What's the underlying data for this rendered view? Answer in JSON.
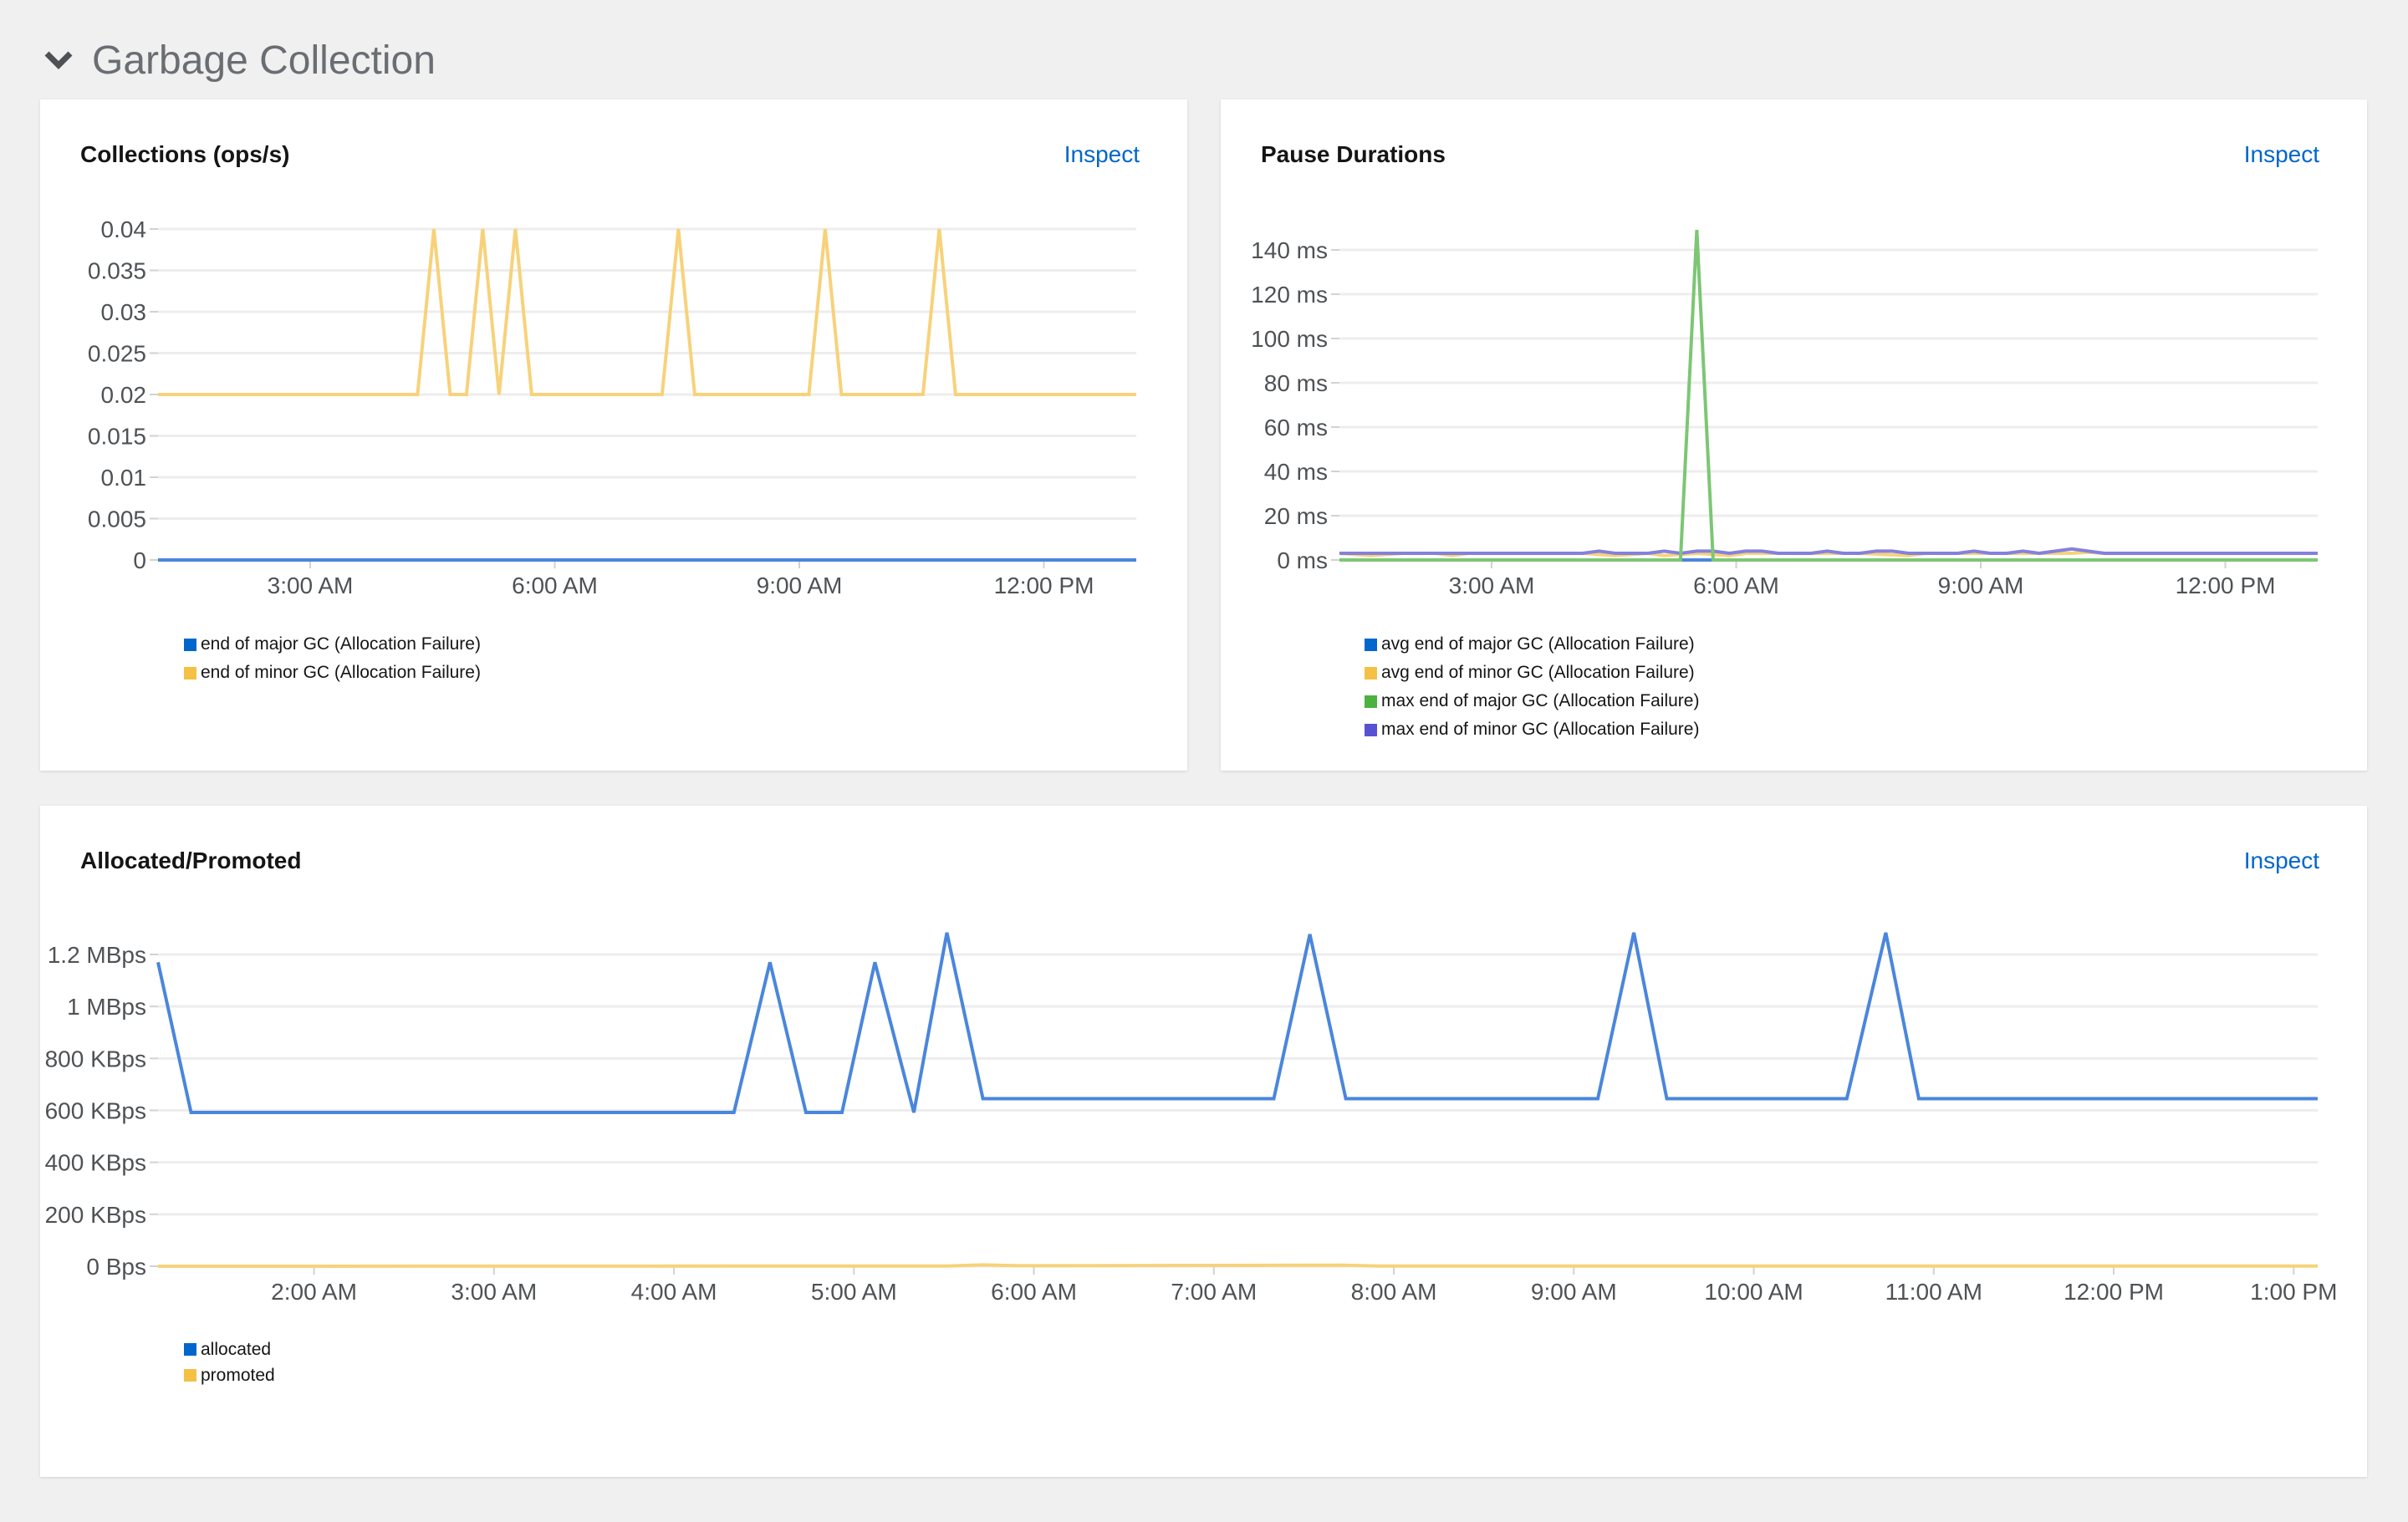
{
  "section": {
    "title": "Garbage Collection",
    "icon": "chevron-down-icon"
  },
  "inspect_label": "Inspect",
  "colors": {
    "blue": "#0066cc",
    "yellow": "#f4c145",
    "green": "#4cb140",
    "purple": "#5752d1",
    "line_blue": "#4a86dc",
    "line_yellow": "#f7d27a",
    "line_green": "#7cc674",
    "line_purple": "#8481dd"
  },
  "chart_data": [
    {
      "id": "collections",
      "type": "line",
      "title": "Collections (ops/s)",
      "x_domain": [
        "01:08",
        "13:08"
      ],
      "x_ticks": [
        {
          "t": "03:00",
          "label": "3:00 AM"
        },
        {
          "t": "06:00",
          "label": "6:00 AM"
        },
        {
          "t": "09:00",
          "label": "9:00 AM"
        },
        {
          "t": "12:00",
          "label": "12:00 PM"
        }
      ],
      "ylim": [
        0,
        0.04
      ],
      "y_ticks": [
        {
          "v": 0,
          "label": "0"
        },
        {
          "v": 0.005,
          "label": "0.005"
        },
        {
          "v": 0.01,
          "label": "0.01"
        },
        {
          "v": 0.015,
          "label": "0.015"
        },
        {
          "v": 0.02,
          "label": "0.02"
        },
        {
          "v": 0.025,
          "label": "0.025"
        },
        {
          "v": 0.03,
          "label": "0.03"
        },
        {
          "v": 0.035,
          "label": "0.035"
        },
        {
          "v": 0.04,
          "label": "0.04"
        }
      ],
      "grid": true,
      "legend": "bottom-left",
      "series": [
        {
          "name": "end of major GC (Allocation Failure)",
          "color": "#4a86dc",
          "legend_color": "#0066cc",
          "points": [
            [
              "01:08",
              0
            ],
            [
              "13:08",
              0
            ]
          ]
        },
        {
          "name": "end of minor GC (Allocation Failure)",
          "color": "#f7d27a",
          "legend_color": "#f4c145",
          "points": [
            [
              "01:08",
              0.02
            ],
            [
              "04:19",
              0.02
            ],
            [
              "04:31",
              0.04
            ],
            [
              "04:43",
              0.02
            ],
            [
              "04:55",
              0.02
            ],
            [
              "05:07",
              0.04
            ],
            [
              "05:19",
              0.02
            ],
            [
              "05:31",
              0.04
            ],
            [
              "05:43",
              0.02
            ],
            [
              "07:19",
              0.02
            ],
            [
              "07:31",
              0.04
            ],
            [
              "07:43",
              0.02
            ],
            [
              "09:07",
              0.02
            ],
            [
              "09:19",
              0.04
            ],
            [
              "09:31",
              0.02
            ],
            [
              "10:31",
              0.02
            ],
            [
              "10:43",
              0.04
            ],
            [
              "10:55",
              0.02
            ],
            [
              "13:08",
              0.02
            ]
          ]
        }
      ]
    },
    {
      "id": "pause",
      "type": "line",
      "title": "Pause Durations",
      "x_domain": [
        "01:08",
        "13:08"
      ],
      "x_ticks": [
        {
          "t": "03:00",
          "label": "3:00 AM"
        },
        {
          "t": "06:00",
          "label": "6:00 AM"
        },
        {
          "t": "09:00",
          "label": "9:00 AM"
        },
        {
          "t": "12:00",
          "label": "12:00 PM"
        }
      ],
      "ylim": [
        0,
        140
      ],
      "y_unit": "ms",
      "y_ticks": [
        {
          "v": 0,
          "label": "0 ms"
        },
        {
          "v": 20,
          "label": "20 ms"
        },
        {
          "v": 40,
          "label": "40 ms"
        },
        {
          "v": 60,
          "label": "60 ms"
        },
        {
          "v": 80,
          "label": "80 ms"
        },
        {
          "v": 100,
          "label": "100 ms"
        },
        {
          "v": 120,
          "label": "120 ms"
        },
        {
          "v": 140,
          "label": "140 ms"
        }
      ],
      "grid": true,
      "legend": "bottom-left",
      "series": [
        {
          "name": "avg end of major GC (Allocation Failure)",
          "color": "#4a86dc",
          "legend_color": "#0066cc",
          "points": [
            [
              "01:08",
              0
            ],
            [
              "13:08",
              0
            ]
          ]
        },
        {
          "name": "avg end of minor GC (Allocation Failure)",
          "color": "#f7d27a",
          "legend_color": "#f4c145",
          "points": [
            [
              "01:08",
              3
            ],
            [
              "01:31",
              2
            ],
            [
              "01:55",
              3
            ],
            [
              "02:19",
              3
            ],
            [
              "02:31",
              2
            ],
            [
              "02:43",
              3
            ],
            [
              "04:07",
              3
            ],
            [
              "04:31",
              2
            ],
            [
              "04:55",
              3
            ],
            [
              "05:07",
              2
            ],
            [
              "05:31",
              3
            ],
            [
              "05:55",
              2
            ],
            [
              "06:07",
              3
            ],
            [
              "07:31",
              3
            ],
            [
              "08:07",
              2
            ],
            [
              "08:19",
              3
            ],
            [
              "09:43",
              3
            ],
            [
              "10:07",
              3
            ],
            [
              "10:19",
              3.5
            ],
            [
              "10:31",
              3
            ],
            [
              "13:08",
              3
            ]
          ]
        },
        {
          "name": "max end of minor GC (Allocation Failure)",
          "color": "#8481dd",
          "legend_color": "#5752d1",
          "points": [
            [
              "01:08",
              3
            ],
            [
              "04:07",
              3
            ],
            [
              "04:19",
              4
            ],
            [
              "04:31",
              3
            ],
            [
              "04:55",
              3
            ],
            [
              "05:07",
              4
            ],
            [
              "05:19",
              3
            ],
            [
              "05:31",
              4
            ],
            [
              "05:43",
              4
            ],
            [
              "05:55",
              3
            ],
            [
              "06:07",
              4
            ],
            [
              "06:19",
              4
            ],
            [
              "06:31",
              3
            ],
            [
              "06:55",
              3
            ],
            [
              "07:07",
              4
            ],
            [
              "07:19",
              3
            ],
            [
              "07:31",
              3
            ],
            [
              "07:43",
              4
            ],
            [
              "07:55",
              4
            ],
            [
              "08:07",
              3
            ],
            [
              "08:43",
              3
            ],
            [
              "08:55",
              4
            ],
            [
              "09:07",
              3
            ],
            [
              "09:19",
              3
            ],
            [
              "09:31",
              4
            ],
            [
              "09:43",
              3
            ],
            [
              "10:07",
              5
            ],
            [
              "10:31",
              3
            ],
            [
              "13:08",
              3
            ]
          ]
        },
        {
          "name": "max end of major GC (Allocation Failure)",
          "color": "#7cc674",
          "legend_color": "#4cb140",
          "points": [
            [
              "01:08",
              0
            ],
            [
              "05:19",
              0
            ],
            [
              "05:31",
              149
            ],
            [
              "05:43",
              0
            ],
            [
              "13:08",
              0
            ]
          ]
        }
      ],
      "legend_order": [
        0,
        1,
        3,
        2
      ]
    },
    {
      "id": "allocated",
      "type": "line",
      "title": "Allocated/Promoted",
      "x_domain": [
        "01:08",
        "13:08"
      ],
      "x_ticks": [
        {
          "t": "02:00",
          "label": "2:00 AM"
        },
        {
          "t": "03:00",
          "label": "3:00 AM"
        },
        {
          "t": "04:00",
          "label": "4:00 AM"
        },
        {
          "t": "05:00",
          "label": "5:00 AM"
        },
        {
          "t": "06:00",
          "label": "6:00 AM"
        },
        {
          "t": "07:00",
          "label": "7:00 AM"
        },
        {
          "t": "08:00",
          "label": "8:00 AM"
        },
        {
          "t": "09:00",
          "label": "9:00 AM"
        },
        {
          "t": "10:00",
          "label": "10:00 AM"
        },
        {
          "t": "11:00",
          "label": "11:00 AM"
        },
        {
          "t": "12:00",
          "label": "12:00 PM"
        },
        {
          "t": "13:00",
          "label": "1:00 PM"
        }
      ],
      "ylim": [
        0,
        1200
      ],
      "y_unit": "KBps",
      "y_ticks": [
        {
          "v": 0,
          "label": "0 Bps"
        },
        {
          "v": 200,
          "label": "200 KBps"
        },
        {
          "v": 400,
          "label": "400 KBps"
        },
        {
          "v": 600,
          "label": "600 KBps"
        },
        {
          "v": 800,
          "label": "800 KBps"
        },
        {
          "v": 1000,
          "label": "1 MBps"
        },
        {
          "v": 1200,
          "label": "1.2 MBps"
        }
      ],
      "grid": true,
      "legend": "bottom-left",
      "series": [
        {
          "name": "allocated",
          "color": "#4a86dc",
          "legend_color": "#0066cc",
          "points": [
            [
              "01:08",
              1170
            ],
            [
              "01:19",
              592
            ],
            [
              "04:20",
              592
            ],
            [
              "04:32",
              1170
            ],
            [
              "04:44",
              592
            ],
            [
              "04:56",
              592
            ],
            [
              "05:07",
              1170
            ],
            [
              "05:20",
              592
            ],
            [
              "05:31",
              1284
            ],
            [
              "05:43",
              645
            ],
            [
              "07:20",
              645
            ],
            [
              "07:32",
              1278
            ],
            [
              "07:44",
              645
            ],
            [
              "09:08",
              645
            ],
            [
              "09:20",
              1284
            ],
            [
              "09:31",
              645
            ],
            [
              "10:31",
              645
            ],
            [
              "10:44",
              1284
            ],
            [
              "10:55",
              645
            ],
            [
              "13:08",
              645
            ]
          ]
        },
        {
          "name": "promoted",
          "color": "#f7d27a",
          "legend_color": "#f4c145",
          "points": [
            [
              "01:08",
              0
            ],
            [
              "05:31",
              1
            ],
            [
              "05:43",
              5
            ],
            [
              "05:55",
              2
            ],
            [
              "07:43",
              4
            ],
            [
              "07:55",
              1
            ],
            [
              "13:08",
              1
            ]
          ]
        }
      ]
    }
  ]
}
